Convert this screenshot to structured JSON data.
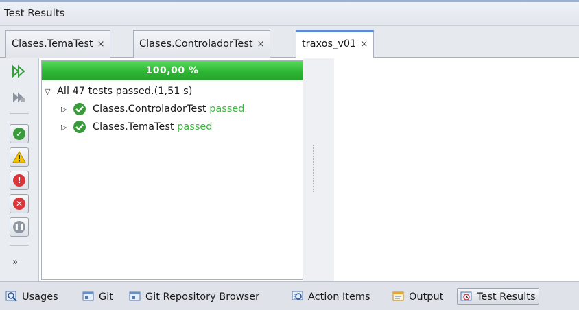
{
  "window": {
    "title": "Test Results"
  },
  "tabs": [
    {
      "label": "Clases.TemaTest",
      "close": "×"
    },
    {
      "label": "Clases.ControladorTest",
      "close": "×"
    },
    {
      "label": "traxos_v01",
      "close": "×"
    }
  ],
  "active_tab": "traxos_v01",
  "toolbar": {
    "items": [
      "rerun-icon",
      "rerun-failed-icon",
      "show-passed-icon",
      "show-passed-with-errors-icon",
      "show-failures-icon",
      "show-errors-icon",
      "show-aborted-icon"
    ],
    "more_label": "»"
  },
  "progress": {
    "label": "100,00 %",
    "value": 1.0
  },
  "tree": {
    "summary": "All 47 tests passed.(1,51 s)",
    "items": [
      {
        "name": "Clases.ControladorTest",
        "status": "passed"
      },
      {
        "name": "Clases.TemaTest",
        "status": "passed"
      }
    ]
  },
  "bottom_bar": {
    "items": [
      {
        "label": "Usages",
        "icon": "usages-icon"
      },
      {
        "label": "Git",
        "icon": "git-icon"
      },
      {
        "label": "Git Repository Browser",
        "icon": "git-repo-browser-icon"
      },
      {
        "label": "Action Items",
        "icon": "action-items-icon"
      },
      {
        "label": "Output",
        "icon": "output-icon"
      },
      {
        "label": "Test Results",
        "icon": "test-results-icon"
      }
    ],
    "active": "Test Results"
  },
  "colors": {
    "progress_green": "#2fb735",
    "passed_text": "#3bb83f",
    "ok_icon": "#3a9a3c",
    "active_tab_accent": "#5b8bd1"
  }
}
